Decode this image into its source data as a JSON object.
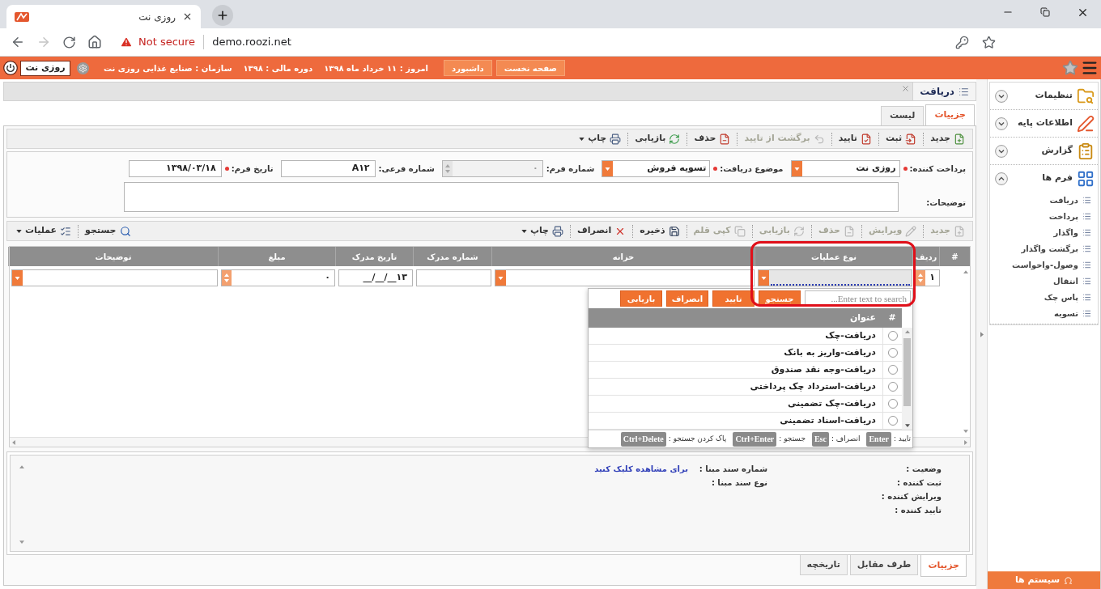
{
  "browser": {
    "tab_title": "روزی نت",
    "security": "Not secure",
    "url": "demo.roozi.net"
  },
  "app_bar": {
    "nav_buttons": [
      "صفحه نخست",
      "داشبورد"
    ],
    "info": [
      "امروز : ۱۱ خرداد ماه ۱۳۹۸",
      "دوره مالی : ۱۳۹۸",
      "سازمان : صنایع غذایی روزی نت"
    ],
    "user": "روزی نت"
  },
  "sidebar": {
    "items": [
      {
        "label": "تنظیمات",
        "kind": "settings",
        "expanded": false
      },
      {
        "label": "اطلاعات پایه",
        "kind": "base",
        "expanded": false
      },
      {
        "label": "گزارش",
        "kind": "report",
        "expanded": false
      },
      {
        "label": "فرم ها",
        "kind": "forms",
        "expanded": true,
        "children": [
          {
            "label": "دریافت"
          },
          {
            "label": "پرداخت"
          },
          {
            "label": "واگذار"
          },
          {
            "label": "برگشت واگذار"
          },
          {
            "label": "وصول-واخواست"
          },
          {
            "label": "انتقال"
          },
          {
            "label": "پاس چک"
          },
          {
            "label": "تسویه"
          }
        ]
      }
    ],
    "footer_button": "سیستم ها"
  },
  "document_tab": {
    "title": "دریافت"
  },
  "view_tabs": [
    {
      "label": "جزییات",
      "selected": true
    },
    {
      "label": "لیست",
      "selected": false
    }
  ],
  "toolbar": [
    {
      "label": "جدید",
      "kind": "new",
      "disabled": false,
      "dropdown": false
    },
    {
      "label": "ثبت",
      "kind": "register",
      "disabled": false,
      "dropdown": false
    },
    {
      "label": "تایید",
      "kind": "confirm",
      "disabled": false,
      "dropdown": false
    },
    {
      "label": "برگشت از تایید",
      "kind": "unconfirm",
      "disabled": true,
      "dropdown": false
    },
    {
      "label": "حذف",
      "kind": "delete",
      "disabled": false,
      "dropdown": false
    },
    {
      "label": "بازیابی",
      "kind": "restore",
      "disabled": false,
      "dropdown": false
    },
    {
      "label": "چاپ",
      "kind": "print",
      "disabled": false,
      "dropdown": true
    }
  ],
  "form": {
    "fields": [
      {
        "label": "پرداخت کننده:",
        "kind": "select",
        "required": true,
        "disabled": false,
        "value": "روزی نت"
      },
      {
        "label": "موضوع دریافت:",
        "kind": "select",
        "required": true,
        "disabled": false,
        "value": "تسویه فروش"
      },
      {
        "label": "شماره فرم:",
        "kind": "number",
        "required": false,
        "disabled": true,
        "value": "۰"
      },
      {
        "label": "شماره فرعی:",
        "kind": "text",
        "required": false,
        "disabled": false,
        "value": "A۱۲"
      },
      {
        "label": "تاریخ فرم:",
        "kind": "text",
        "required": true,
        "disabled": false,
        "value": "۱۳۹۸/۰۳/۱۸"
      }
    ],
    "notes_label": "توضیحات:"
  },
  "items_toolbar": {
    "actions": [
      {
        "label": "جدید",
        "kind": "new",
        "disabled": true,
        "dropdown": false
      },
      {
        "label": "ویرایش",
        "kind": "edit",
        "disabled": true,
        "dropdown": false
      },
      {
        "label": "حذف",
        "kind": "delete",
        "disabled": true,
        "dropdown": false
      },
      {
        "label": "بازیابی",
        "kind": "restore",
        "disabled": true,
        "dropdown": false
      },
      {
        "label": "کپی قلم",
        "kind": "copy",
        "disabled": true,
        "dropdown": false
      },
      {
        "label": "ذخیره",
        "kind": "save",
        "disabled": false,
        "dropdown": false
      },
      {
        "label": "انصراف",
        "kind": "cancel",
        "disabled": false,
        "dropdown": false
      },
      {
        "label": "چاپ",
        "kind": "print",
        "disabled": false,
        "dropdown": true
      }
    ],
    "tools": [
      {
        "label": "جستجو",
        "kind": "search",
        "disabled": false,
        "dropdown": false
      },
      {
        "label": "عملیات",
        "kind": "operations",
        "disabled": false,
        "dropdown": true
      }
    ]
  },
  "grid": {
    "columns": [
      "#",
      "ردیف",
      "نوع عملیات",
      "خزانه",
      "شماره مدرک",
      "تاریخ مدرک",
      "مبلغ",
      "توضیحات"
    ],
    "rows": [
      {
        "row_number": "۱",
        "operation_focused": true,
        "document_date": "۱۳__/__/__",
        "amount": "۰"
      }
    ]
  },
  "lookup": {
    "search_placeholder": "Enter text to search...",
    "buttons": [
      "جستجو",
      "تایید",
      "انصراف",
      "بازیابی"
    ],
    "columns": [
      "#",
      "عنوان"
    ],
    "options": [
      {
        "label": "دریافت-چک",
        "selected": false
      },
      {
        "label": "دریافت-واریز به بانک",
        "selected": false
      },
      {
        "label": "دریافت-وجه نقد صندوق",
        "selected": false
      },
      {
        "label": "دریافت-استرداد چک پرداختی",
        "selected": false
      },
      {
        "label": "دریافت-چک تضمینی",
        "selected": false
      },
      {
        "label": "دریافت-اسناد تضمینی",
        "selected": false
      }
    ],
    "shortcuts": [
      {
        "label": "تایید :",
        "key": "Enter"
      },
      {
        "label": "انصراف :",
        "key": "Esc"
      },
      {
        "label": "جستجو :",
        "key": "Ctrl+Enter"
      },
      {
        "label": "پاک کردن جستجو :",
        "key": "Ctrl+Delete"
      }
    ]
  },
  "details": {
    "labels": [
      "وضعیت :",
      "ثبت کننده :",
      "ویرایش کننده :",
      "تایید کننده :"
    ],
    "source": [
      {
        "label": "شماره سند مبنا :",
        "link": "برای مشاهده کلیک کنید"
      },
      {
        "label": "نوع سند مبنا :"
      }
    ]
  },
  "bottom_tabs": [
    {
      "label": "جزییات",
      "selected": true
    },
    {
      "label": "طرف مقابل",
      "selected": false
    },
    {
      "label": "تاریخچه",
      "selected": false
    }
  ]
}
